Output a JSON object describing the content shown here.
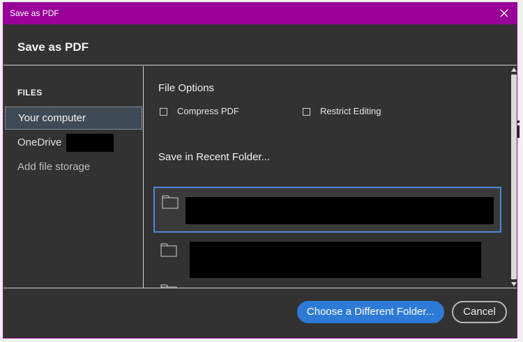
{
  "titlebar": {
    "title": "Save as PDF",
    "close_icon": "close-icon"
  },
  "header": {
    "title": "Save as PDF"
  },
  "sidebar": {
    "section_label": "FILES",
    "items": [
      {
        "label": "Your computer",
        "selected": true
      },
      {
        "label": "OneDrive",
        "redacted": true
      },
      {
        "label": "Add file storage"
      }
    ]
  },
  "main": {
    "file_options_label": "File Options",
    "options": [
      {
        "label": "Compress PDF",
        "checked": false
      },
      {
        "label": "Restrict Editing",
        "checked": false
      }
    ],
    "recent_label": "Save in Recent Folder...",
    "folder_icon": "folder-icon"
  },
  "footer": {
    "primary_label": "Choose a Different Folder...",
    "cancel_label": "Cancel"
  },
  "colors": {
    "titlebar": "#990099",
    "accent": "#2d7ad6",
    "panel": "#323232"
  }
}
